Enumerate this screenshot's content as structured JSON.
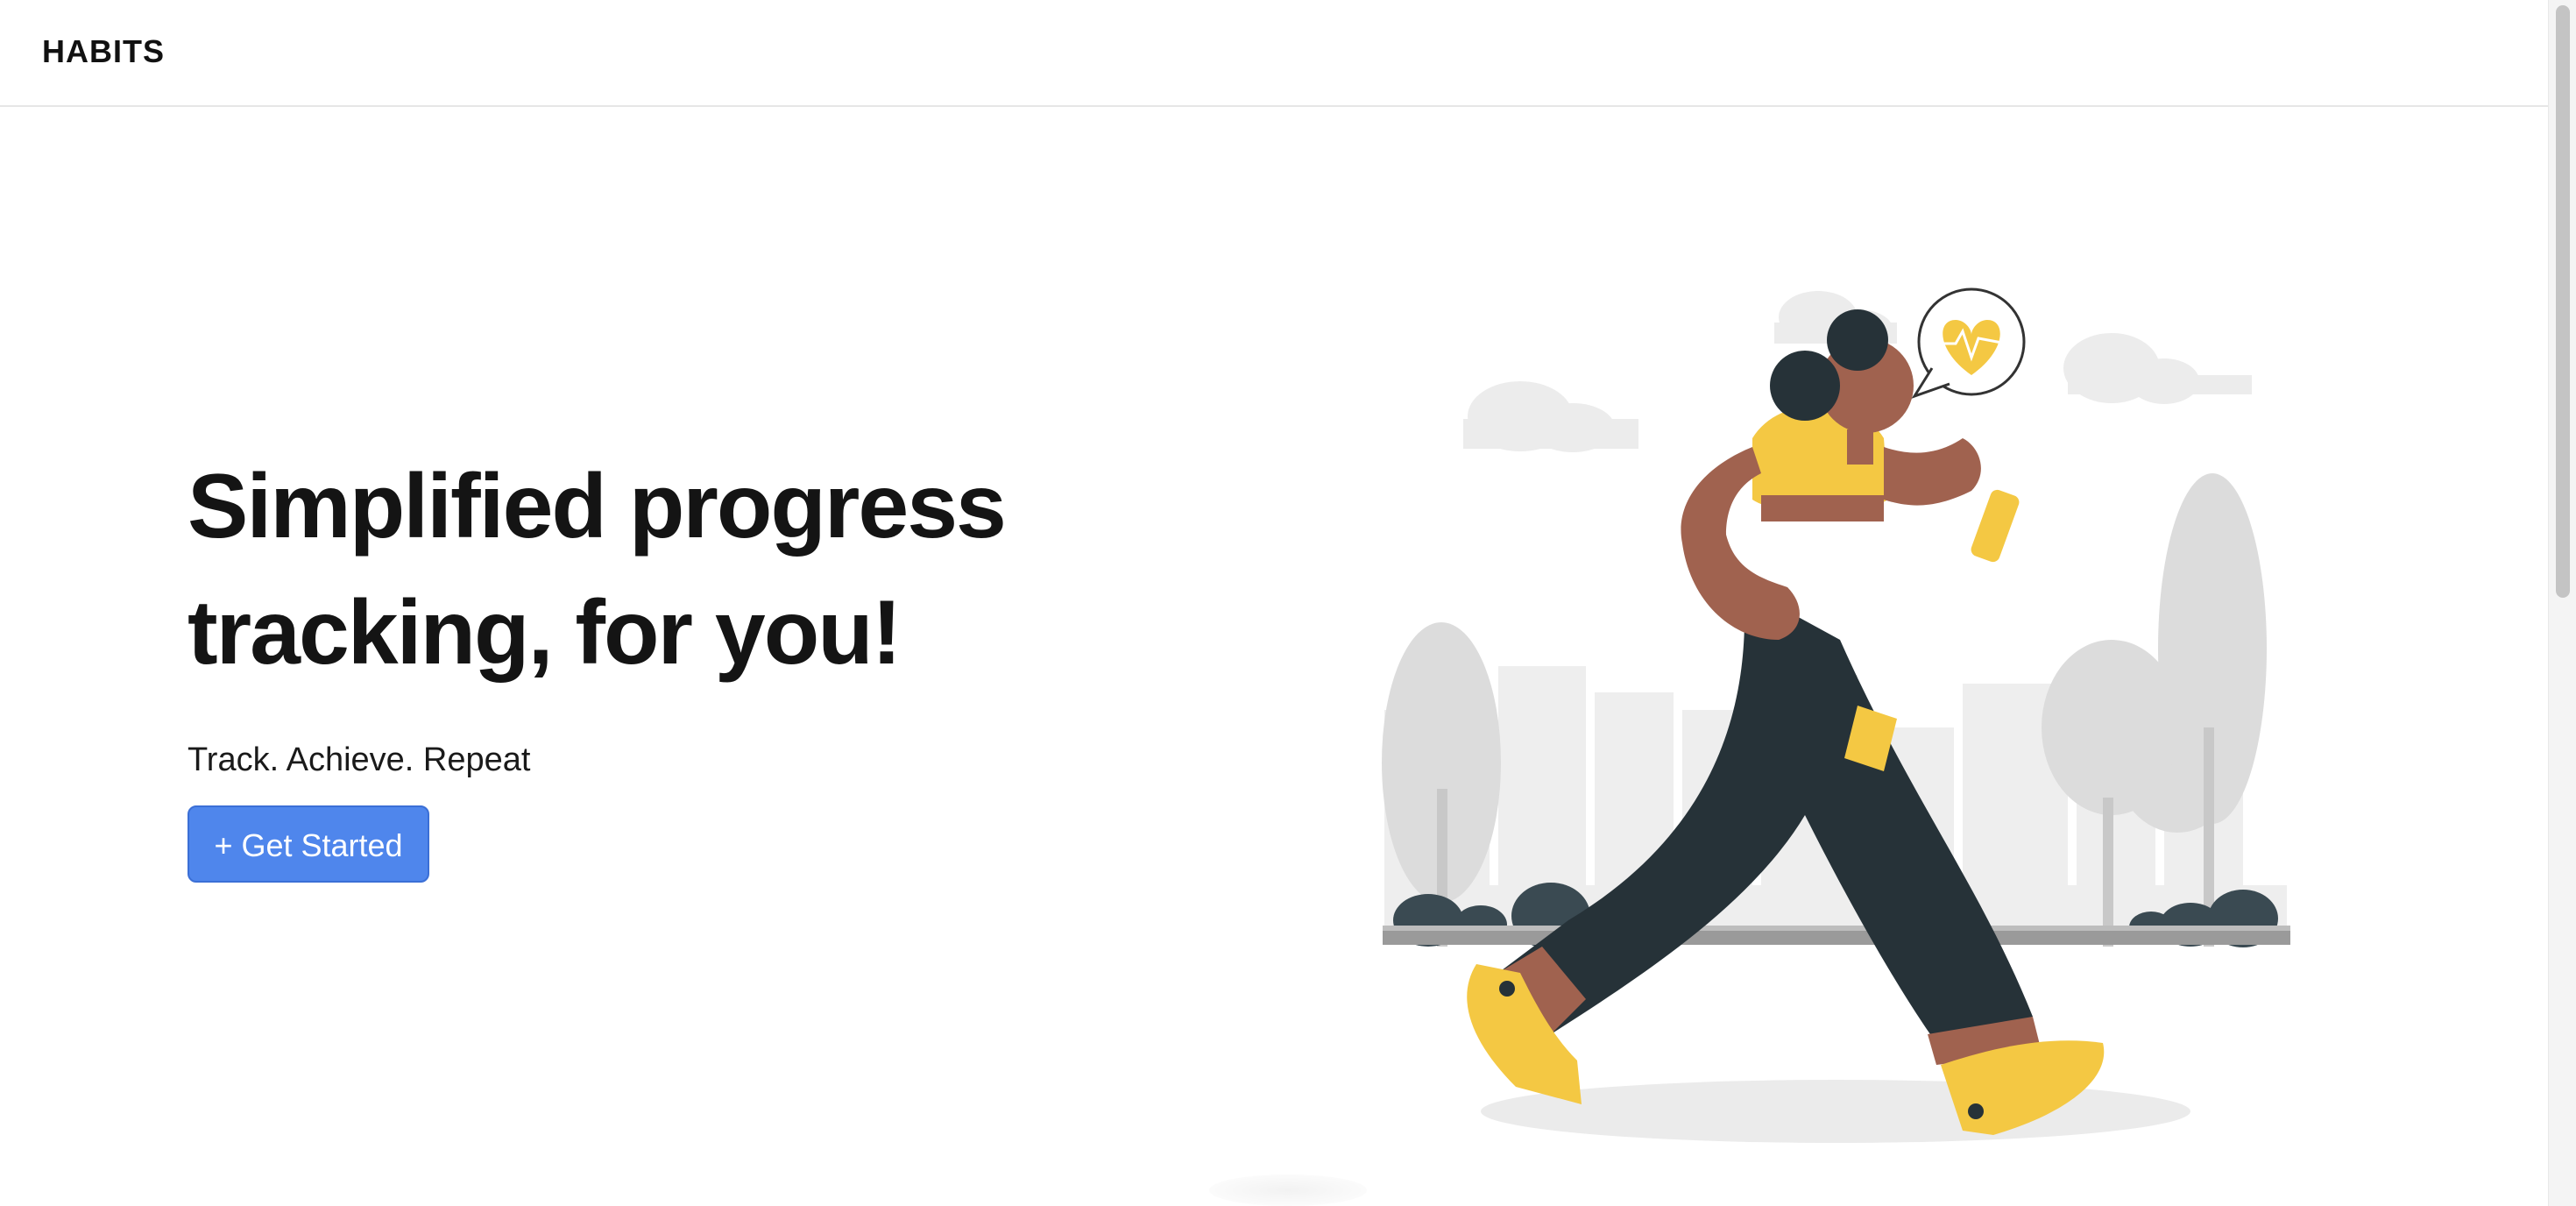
{
  "navbar": {
    "brand": "HABITS"
  },
  "hero": {
    "title_line1": "Simplified progress",
    "title_line2": "tracking, for you!",
    "subtitle": "Track. Achieve. Repeat",
    "cta_label": "+ Get Started"
  },
  "illustration": {
    "icon_name": "woman-walking-with-water-bottle",
    "bubble_icon": "heart-pulse-icon",
    "colors": {
      "accent_yellow": "#f4c843",
      "skin": "#a0624f",
      "pants": "#263238",
      "background_gray": "#e0e0e0"
    }
  },
  "colors": {
    "primary_button": "#4f86ec",
    "text": "#141414"
  }
}
